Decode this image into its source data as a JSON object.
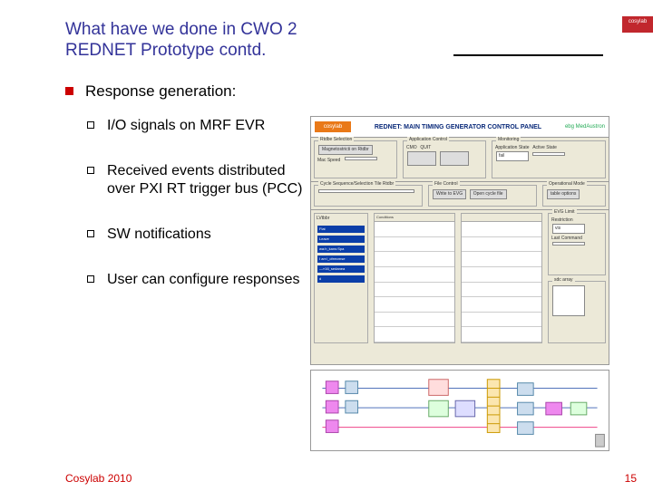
{
  "title_line1": "What have we done in CWO 2",
  "title_line2": "REDNET Prototype contd.",
  "heading": "Response generation:",
  "bullets": [
    "I/O signals on MRF EVR",
    "Received events distributed over PXI RT trigger bus (PCC)",
    "SW notifications",
    "User can configure responses"
  ],
  "footer": "Cosylab 2010",
  "page_number": "15",
  "logo_text": "cosylab",
  "panel": {
    "header_logo": "cosylab",
    "header_title": "REDNET: MAIN TIMING GENERATOR CONTROL PANEL",
    "header_brand": "ebg MedAustron",
    "group_rtdb": "Rtdbe Selection",
    "rtdb_btn": "Magnetostricti on Rtdbr",
    "mac_label": "Mac Speed",
    "group_app": "Application Control",
    "app_label1": "CMO",
    "app_label2": "QUIT",
    "group_mon": "Monitoring",
    "mon_label1": "Application State",
    "mon_label2": "Active State",
    "mon_field": "fail",
    "group_cycle": "Cycle Sequence/Selection Tile Rtdbr",
    "cycle_field": "",
    "group_file": "File Control",
    "item_label": "LVtbbr",
    "list_items": [
      "Flat",
      "Leave",
      "wa:h_kans:Spa",
      "I arr:l_cfeecmse",
      "—»16_sedanea",
      "d"
    ],
    "col_headers": [
      "Conditions",
      "Write to EVG",
      "Open cycle file"
    ],
    "right_group1": "Operational Mode",
    "right_field1": "table options",
    "right_group2": "EVG Limit",
    "right_label2a": "Restriction",
    "right_label2b": "Last Command",
    "right_field2a": "vis",
    "right_group3": "sdc array"
  },
  "chart_data": {
    "type": "table",
    "title": "REDNET: MAIN TIMING GENERATOR CONTROL PANEL",
    "categories": [
      "Conditions",
      "Write to EVG",
      "Open cycle file"
    ],
    "values": []
  }
}
